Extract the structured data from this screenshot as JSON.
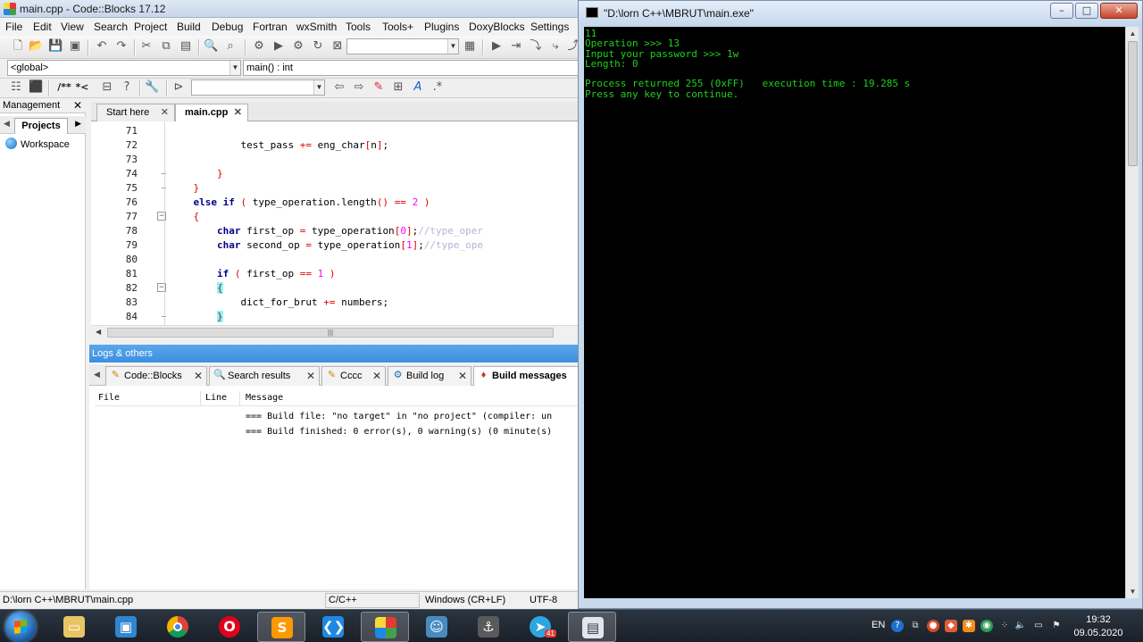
{
  "codeblocks": {
    "title": "main.cpp - Code::Blocks 17.12",
    "menu": [
      "File",
      "Edit",
      "View",
      "Search",
      "Project",
      "Build",
      "Debug",
      "Fortran",
      "wxSmith",
      "Tools",
      "Tools+",
      "Plugins",
      "DoxyBlocks",
      "Settings"
    ],
    "scope_combo": "<global>",
    "symbol_combo": "main() : int",
    "comment_buttons": [
      "/**",
      "*<"
    ],
    "management": {
      "title": "Management",
      "tab": "Projects",
      "tree_root": "Workspace"
    },
    "editor_tabs": [
      {
        "label": "Start here"
      },
      {
        "label": "main.cpp"
      }
    ],
    "line_numbers": [
      "71",
      "72",
      "73",
      "74",
      "75",
      "76",
      "77",
      "78",
      "79",
      "80",
      "81",
      "82",
      "83",
      "84"
    ],
    "code": {
      "l72_a": "test_pass",
      "l72_b": "eng_char",
      "l72_c": "n",
      "l76_a": "else if",
      "l76_b": "type_operation.length",
      "l76_c": "2",
      "l78_a": "char",
      "l78_b": "first_op",
      "l78_c": "type_operation",
      "l78_d": "0",
      "l78_e": "//type_oper",
      "l79_a": "char",
      "l79_b": "second_op",
      "l79_c": "type_operation",
      "l79_d": "1",
      "l79_e": "//type_ope",
      "l81_a": "if",
      "l81_b": "first_op",
      "l81_c": "1",
      "l83_a": "dict_for_brut",
      "l83_b": "numbers"
    },
    "logs": {
      "title": "Logs & others",
      "tabs": [
        "Code::Blocks",
        "Search results",
        "Cccc",
        "Build log",
        "Build messages"
      ],
      "columns": [
        "File",
        "Line",
        "Message"
      ],
      "messages": [
        "=== Build file: \"no target\" in \"no project\" (compiler: un",
        "=== Build finished: 0 error(s), 0 warning(s) (0 minute(s)"
      ]
    },
    "status": {
      "path": "D:\\lorn C++\\MBRUT\\main.cpp",
      "language": "C/C++",
      "eol": "Windows (CR+LF)",
      "encoding": "UTF-8"
    }
  },
  "console": {
    "title": "\"D:\\lorn C++\\MBRUT\\main.exe\"",
    "lines": [
      "11",
      "Operation >>> 13",
      "Input your password >>> 1w",
      "Length: 0",
      "",
      "Process returned 255 (0xFF)   execution time : 19.285 s",
      "Press any key to continue."
    ],
    "text_color": "#1ed21e"
  },
  "taskbar": {
    "lang": "EN",
    "time": "19:32",
    "date": "09.05.2020",
    "telegram_badge": "41"
  }
}
